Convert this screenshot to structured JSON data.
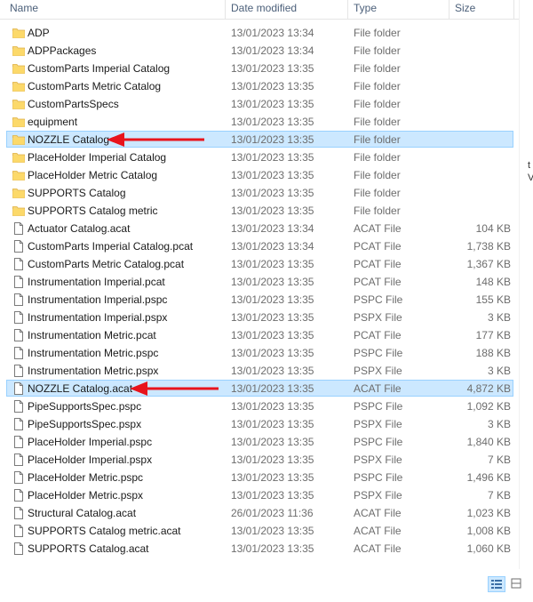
{
  "columns": {
    "name": "Name",
    "date_modified": "Date modified",
    "type": "Type",
    "size": "Size"
  },
  "files": [
    {
      "name": "ADP",
      "date": "13/01/2023 13:34",
      "type": "File folder",
      "size": "",
      "icon": "folder-icon"
    },
    {
      "name": "ADPPackages",
      "date": "13/01/2023 13:34",
      "type": "File folder",
      "size": "",
      "icon": "folder-icon"
    },
    {
      "name": "CustomParts Imperial Catalog",
      "date": "13/01/2023 13:35",
      "type": "File folder",
      "size": "",
      "icon": "folder-icon"
    },
    {
      "name": "CustomParts Metric Catalog",
      "date": "13/01/2023 13:35",
      "type": "File folder",
      "size": "",
      "icon": "folder-icon"
    },
    {
      "name": "CustomPartsSpecs",
      "date": "13/01/2023 13:35",
      "type": "File folder",
      "size": "",
      "icon": "folder-icon"
    },
    {
      "name": "equipment",
      "date": "13/01/2023 13:35",
      "type": "File folder",
      "size": "",
      "icon": "folder-icon"
    },
    {
      "name": "NOZZLE Catalog",
      "date": "13/01/2023 13:35",
      "type": "File folder",
      "size": "",
      "icon": "folder-icon",
      "selected": true,
      "annotated": true
    },
    {
      "name": "PlaceHolder Imperial Catalog",
      "date": "13/01/2023 13:35",
      "type": "File folder",
      "size": "",
      "icon": "folder-icon"
    },
    {
      "name": "PlaceHolder Metric Catalog",
      "date": "13/01/2023 13:35",
      "type": "File folder",
      "size": "",
      "icon": "folder-icon"
    },
    {
      "name": "SUPPORTS Catalog",
      "date": "13/01/2023 13:35",
      "type": "File folder",
      "size": "",
      "icon": "folder-icon"
    },
    {
      "name": "SUPPORTS Catalog metric",
      "date": "13/01/2023 13:35",
      "type": "File folder",
      "size": "",
      "icon": "folder-icon"
    },
    {
      "name": "Actuator Catalog.acat",
      "date": "13/01/2023 13:34",
      "type": "ACAT File",
      "size": "104 KB",
      "icon": "file-icon"
    },
    {
      "name": "CustomParts Imperial Catalog.pcat",
      "date": "13/01/2023 13:34",
      "type": "PCAT File",
      "size": "1,738 KB",
      "icon": "file-icon"
    },
    {
      "name": "CustomParts Metric Catalog.pcat",
      "date": "13/01/2023 13:35",
      "type": "PCAT File",
      "size": "1,367 KB",
      "icon": "file-icon"
    },
    {
      "name": "Instrumentation Imperial.pcat",
      "date": "13/01/2023 13:35",
      "type": "PCAT File",
      "size": "148 KB",
      "icon": "file-icon"
    },
    {
      "name": "Instrumentation Imperial.pspc",
      "date": "13/01/2023 13:35",
      "type": "PSPC File",
      "size": "155 KB",
      "icon": "file-icon"
    },
    {
      "name": "Instrumentation Imperial.pspx",
      "date": "13/01/2023 13:35",
      "type": "PSPX File",
      "size": "3 KB",
      "icon": "file-icon"
    },
    {
      "name": "Instrumentation Metric.pcat",
      "date": "13/01/2023 13:35",
      "type": "PCAT File",
      "size": "177 KB",
      "icon": "file-icon"
    },
    {
      "name": "Instrumentation Metric.pspc",
      "date": "13/01/2023 13:35",
      "type": "PSPC File",
      "size": "188 KB",
      "icon": "file-icon"
    },
    {
      "name": "Instrumentation Metric.pspx",
      "date": "13/01/2023 13:35",
      "type": "PSPX File",
      "size": "3 KB",
      "icon": "file-icon"
    },
    {
      "name": "NOZZLE Catalog.acat",
      "date": "13/01/2023 13:35",
      "type": "ACAT File",
      "size": "4,872 KB",
      "icon": "file-icon",
      "selected": true,
      "annotated": true
    },
    {
      "name": "PipeSupportsSpec.pspc",
      "date": "13/01/2023 13:35",
      "type": "PSPC File",
      "size": "1,092 KB",
      "icon": "file-icon"
    },
    {
      "name": "PipeSupportsSpec.pspx",
      "date": "13/01/2023 13:35",
      "type": "PSPX File",
      "size": "3 KB",
      "icon": "file-icon"
    },
    {
      "name": "PlaceHolder Imperial.pspc",
      "date": "13/01/2023 13:35",
      "type": "PSPC File",
      "size": "1,840 KB",
      "icon": "file-icon"
    },
    {
      "name": "PlaceHolder Imperial.pspx",
      "date": "13/01/2023 13:35",
      "type": "PSPX File",
      "size": "7 KB",
      "icon": "file-icon"
    },
    {
      "name": "PlaceHolder Metric.pspc",
      "date": "13/01/2023 13:35",
      "type": "PSPC File",
      "size": "1,496 KB",
      "icon": "file-icon"
    },
    {
      "name": "PlaceHolder Metric.pspx",
      "date": "13/01/2023 13:35",
      "type": "PSPX File",
      "size": "7 KB",
      "icon": "file-icon"
    },
    {
      "name": "Structural Catalog.acat",
      "date": "26/01/2023 11:36",
      "type": "ACAT File",
      "size": "1,023 KB",
      "icon": "file-icon"
    },
    {
      "name": "SUPPORTS Catalog metric.acat",
      "date": "13/01/2023 13:35",
      "type": "ACAT File",
      "size": "1,008 KB",
      "icon": "file-icon"
    },
    {
      "name": "SUPPORTS Catalog.acat",
      "date": "13/01/2023 13:35",
      "type": "ACAT File",
      "size": "1,060 KB",
      "icon": "file-icon"
    }
  ],
  "clipped_text": [
    "t",
    "V"
  ],
  "colors": {
    "selection": "#cce8ff",
    "selection_border": "#99d1ff",
    "arrow": "#e8141c",
    "folder": "#f8d775"
  },
  "view_buttons": [
    "details-view-icon",
    "large-icons-view-icon"
  ]
}
